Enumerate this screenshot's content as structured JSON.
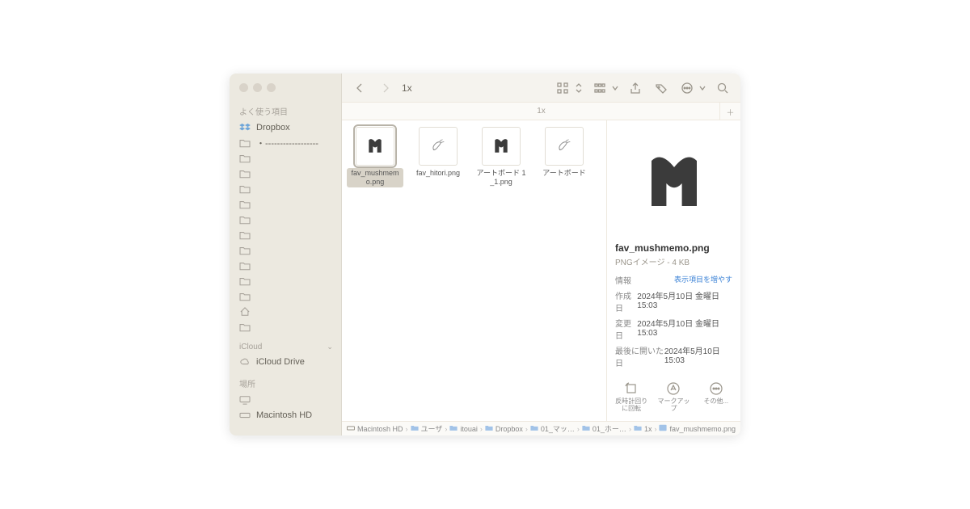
{
  "toolbar": {
    "title": "1x"
  },
  "subheader": {
    "label": "1x"
  },
  "sidebar": {
    "favorites_label": "よく使う項目",
    "dropbox": "Dropbox",
    "masked_item": "・------------------",
    "icloud_label": "iCloud",
    "icloud_drive": "iCloud Drive",
    "locations_label": "場所",
    "mac_hd": "Macintosh HD"
  },
  "files": [
    {
      "name": "fav_mushmemo.png",
      "selected": true,
      "kind": "m"
    },
    {
      "name": "fav_hitori.png",
      "selected": false,
      "kind": "sketch"
    },
    {
      "name": "アートボード 1_1.png",
      "selected": false,
      "kind": "m"
    },
    {
      "name": "アートボード",
      "selected": false,
      "kind": "sketch"
    }
  ],
  "preview": {
    "title": "fav_mushmemo.png",
    "subtitle": "PNGイメージ - 4 KB",
    "info_label": "情報",
    "show_more": "表示項目を増やす",
    "created_label": "作成日",
    "created_value": "2024年5月10日 金曜日 15:03",
    "modified_label": "変更日",
    "modified_value": "2024年5月10日 金曜日 15:03",
    "opened_label": "最後に開いた日",
    "opened_value": "2024年5月10日 15:03",
    "action_rotate": "反時計回りに回転",
    "action_markup": "マークアップ",
    "action_more": "その他..."
  },
  "pathbar": [
    "Macintosh HD",
    "ユーザ",
    "itouai",
    "Dropbox",
    "01_マッ…",
    "01_ホー…",
    "1x",
    "fav_mushmemo.png"
  ]
}
